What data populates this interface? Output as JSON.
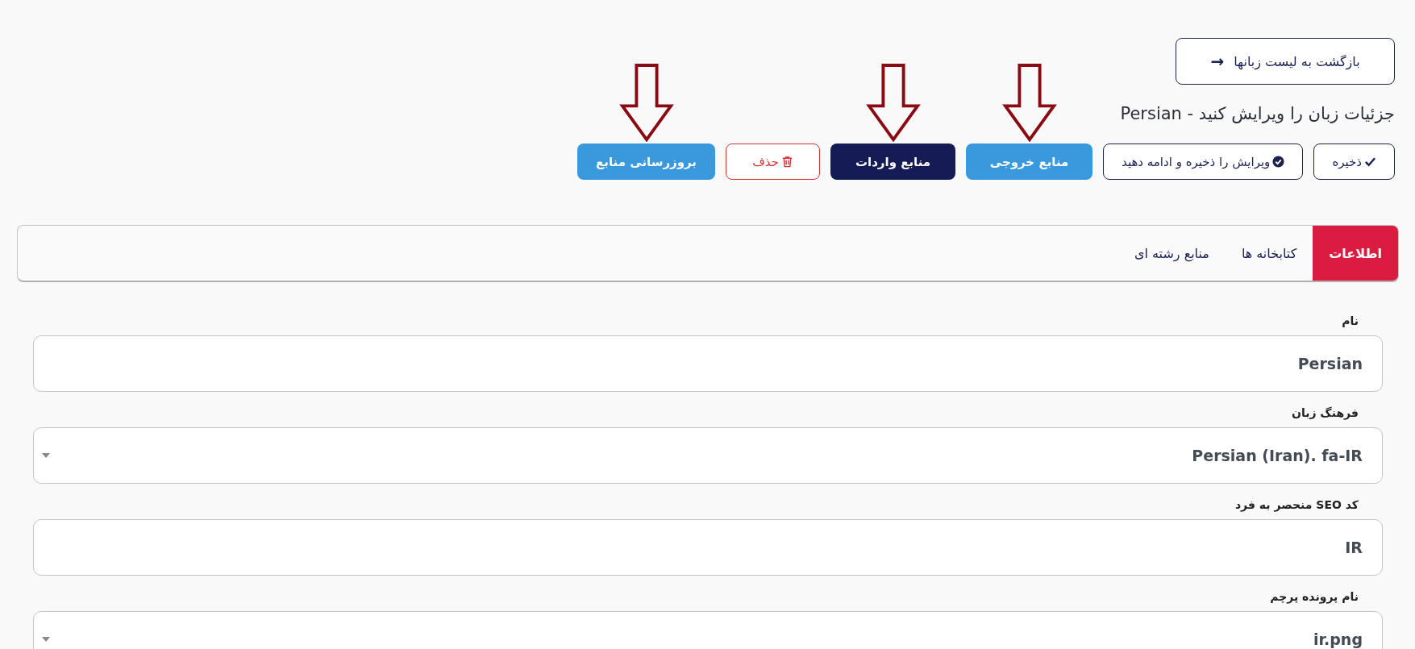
{
  "back_button": {
    "label": "بازگشت به لیست زبانها",
    "icon": "→"
  },
  "title": "جزئیات زبان را ویرایش کنید - Persian",
  "actions": [
    {
      "label": "ذخیره",
      "kind": "save",
      "arrow": false
    },
    {
      "label": "ویرایش را ذخیره و ادامه دهید",
      "kind": "continue",
      "arrow": false
    },
    {
      "label": "منابع خروجی",
      "kind": "export",
      "arrow": true
    },
    {
      "label": "منابع واردات",
      "kind": "import",
      "arrow": true
    },
    {
      "label": "حذف",
      "kind": "delete",
      "arrow": false
    },
    {
      "label": "بروزرسانی منابع",
      "kind": "refresh",
      "arrow": true
    }
  ],
  "tabs": [
    {
      "label": "اطلاعات",
      "selected": true
    },
    {
      "label": "کتابخانه ها",
      "selected": false
    },
    {
      "label": "منابع رشته ای",
      "selected": false
    }
  ],
  "fields": [
    {
      "label": "نام",
      "kind": "text",
      "value": "Persian"
    },
    {
      "label": "فرهنگ زبان",
      "kind": "select",
      "value": "Persian (Iran). fa-IR"
    },
    {
      "label": "کد SEO منحصر به فرد",
      "kind": "text",
      "value": "IR"
    },
    {
      "label": "نام پرونده پرچم",
      "kind": "select",
      "value": "ir.png"
    }
  ]
}
